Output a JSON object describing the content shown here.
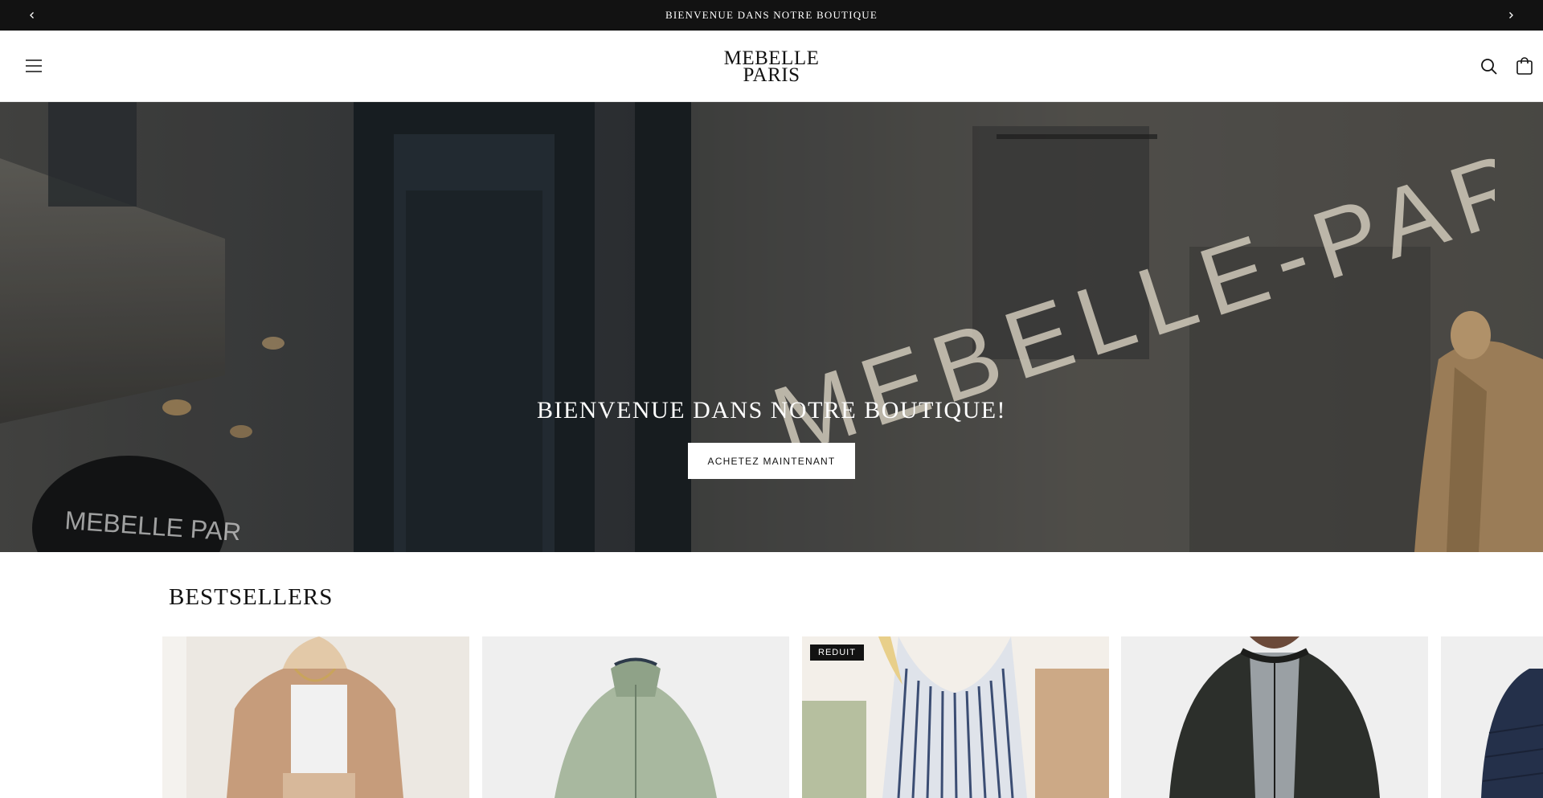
{
  "announcement": {
    "message": "BIENVENUE DANS NOTRE BOUTIQUE",
    "prev_icon": "chevron-left-icon",
    "next_icon": "chevron-right-icon"
  },
  "header": {
    "logo_line1": "MEBELLE",
    "logo_line2": "PARIS",
    "menu_icon": "hamburger-menu-icon",
    "search_icon": "search-icon",
    "cart_icon": "shopping-bag-icon"
  },
  "hero": {
    "title": "BIENVENUE DANS NOTRE BOUTIQUE!",
    "button_label": "ACHETEZ MAINTENANT",
    "storefront_sign": "MEBELLE-PARIS",
    "awning_sign": "MEBELLE PARIS"
  },
  "bestsellers": {
    "title": "BESTSELLERS",
    "products": [
      {
        "badge": ""
      },
      {
        "badge": ""
      },
      {
        "badge": "REDUIT"
      },
      {
        "badge": ""
      },
      {
        "badge": ""
      }
    ]
  },
  "colors": {
    "announcement_bg": "#121212",
    "text": "#121212",
    "background": "#ffffff"
  }
}
